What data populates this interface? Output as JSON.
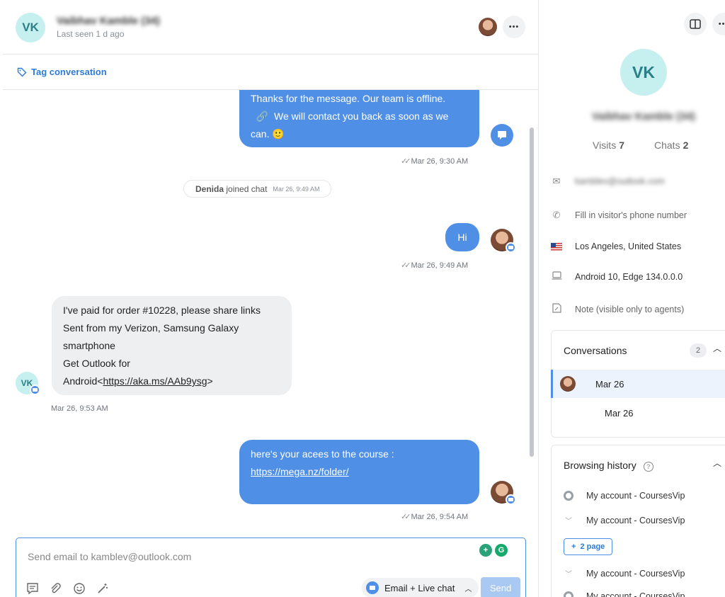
{
  "visitor": {
    "initials": "VK",
    "name": "Vaibhav Kamble (34)",
    "last_seen": "Last seen 1 d ago"
  },
  "header": {
    "more_icon": "•••",
    "layout_icon": "panel-toggle-icon"
  },
  "tag": {
    "label": "Tag conversation"
  },
  "messages": [
    {
      "text_lines": [
        "Thanks for the message. Our team is offline.",
        "  🔗  We will contact you back as soon as we",
        "can. 🙂"
      ],
      "time": "Mar 26, 9:30 AM"
    },
    {
      "text": "Hi",
      "time": "Mar 26, 9:49 AM"
    },
    {
      "text_lines": [
        "I've paid for order #10228, please share links",
        "Sent from my Verizon, Samsung Galaxy",
        "smartphone",
        "Get Outlook for",
        "Android<"
      ],
      "link": "https://aka.ms/AAb9ysg",
      "suffix": ">",
      "time": "Mar 26, 9:53 AM"
    },
    {
      "text": "here's your acees to the course :",
      "link": "https://mega.nz/folder/",
      "time": "Mar 26, 9:54 AM"
    }
  ],
  "system": {
    "agent": "Denida",
    "action": "joined chat",
    "time": "Mar 26, 9:49 AM"
  },
  "composer": {
    "placeholder": "Send email to kamblev@outlook.com",
    "channel": "Email + Live chat",
    "send": "Send"
  },
  "details": {
    "visits_label": "Visits",
    "visits": "7",
    "chats_label": "Chats",
    "chats": "2",
    "email": "kamblev@outlook.com",
    "phone_placeholder": "Fill in visitor's phone number",
    "location": "Los Angeles, United States",
    "device": "Android 10, Edge 134.0.0.0",
    "note_placeholder": "Note (visible only to agents)"
  },
  "conversations": {
    "title": "Conversations",
    "count": "2",
    "items": [
      "Mar 26",
      "Mar 26"
    ]
  },
  "browsing": {
    "title": "Browsing history",
    "pages": [
      "My account - CoursesVip",
      "My account - CoursesVip",
      "My account - CoursesVip",
      "My account - CoursesVip"
    ],
    "more": "2 page"
  },
  "colors": {
    "accent": "#4f8fe6",
    "visitor_avatar": "#c6eff0"
  }
}
